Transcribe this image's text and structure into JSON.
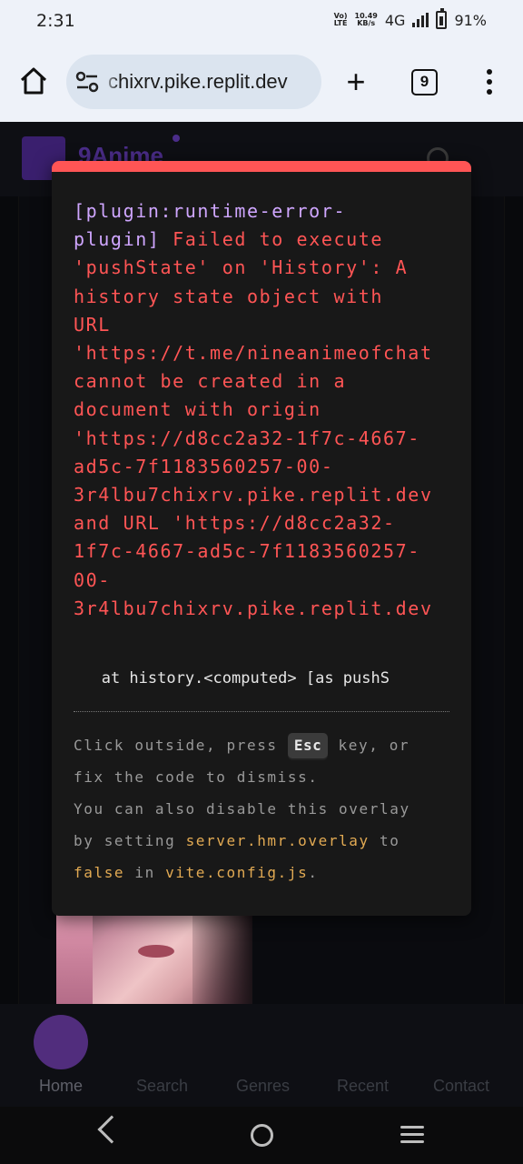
{
  "status_bar": {
    "time": "2:31",
    "volte": "Vo) LTE",
    "speed": "10.49",
    "speed_unit": "KB/s",
    "network": "4G",
    "battery": "91%"
  },
  "browser": {
    "url": "chixrv.pike.replit.dev",
    "tab_count": "9"
  },
  "page": {
    "logo_text": "9Anime",
    "nav": [
      "Home",
      "Search",
      "Genres",
      "Recent",
      "Contact"
    ]
  },
  "error_overlay": {
    "plugin": "[plugin:runtime-error-\nplugin]",
    "message": " Failed to execute\n'pushState' on 'History': A\nhistory state object with\nURL\n'https://t.me/nineanimeofchat\ncannot be created in a\ndocument with origin\n'https://d8cc2a32-1f7c-4667-\nad5c-7f1183560257-00-\n3r4lbu7chixrv.pike.replit.dev\nand URL 'https://d8cc2a32-\n1f7c-4667-ad5c-7f1183560257-\n00-\n3r4lbu7chixrv.pike.replit.dev",
    "stack": "   at history.<computed> [as pushS",
    "tip_line1_a": "Click outside, press ",
    "tip_key": "Esc",
    "tip_line1_b": " key, or",
    "tip_line2": "fix the code to dismiss.",
    "tip_line3": "You can also disable this overlay",
    "tip_line4_a": "by setting ",
    "tip_code1": "server.hmr.overlay",
    "tip_line4_b": " to",
    "tip_code2": "false",
    "tip_line5_a": " in ",
    "tip_code3": "vite.config.js",
    "tip_line5_b": "."
  },
  "colors": {
    "error_red": "#ff5555",
    "plugin_purple": "#cfa6ff",
    "code_orange": "#e2aa53",
    "accent_purple": "#512d7d"
  }
}
